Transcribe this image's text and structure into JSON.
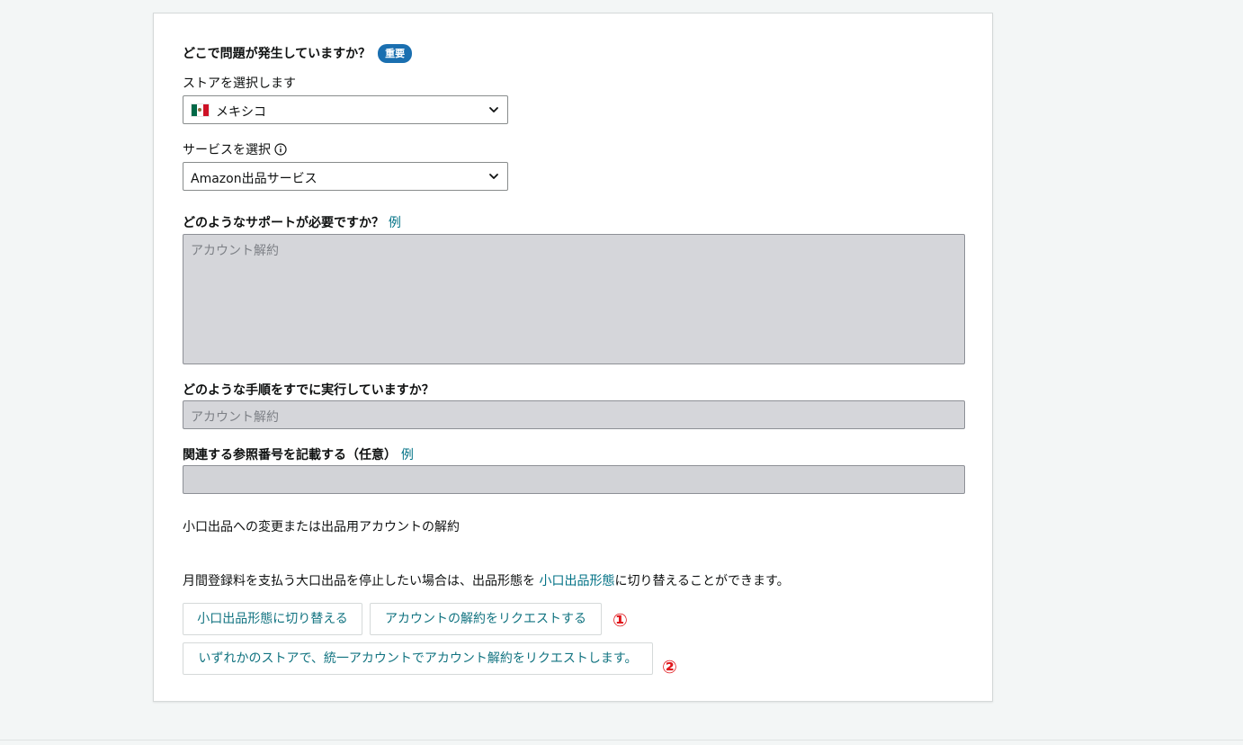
{
  "question1": {
    "title": "どこで問題が発生していますか？",
    "badge": "重要"
  },
  "store": {
    "label": "ストアを選択します",
    "value": "メキシコ",
    "flag_icon": "mexico-flag-icon"
  },
  "service": {
    "label": "サービスを選択",
    "value": "Amazon出品サービス",
    "info_icon": "info-icon"
  },
  "support": {
    "title": "どのようなサポートが必要ですか？",
    "example_link": "例",
    "placeholder": "アカウント解約"
  },
  "steps": {
    "title": "どのような手順をすでに実行していますか？",
    "placeholder": "アカウント解約"
  },
  "reference": {
    "title": "関連する参照番号を記載する（任意）",
    "example_link": "例",
    "value": ""
  },
  "section": {
    "heading": "小口出品への変更または出品用アカウントの解約",
    "description_before": "月間登録料を支払う大口出品を停止したい場合は、出品形態を ",
    "description_link": "小口出品形態",
    "description_after": "に切り替えることができます。"
  },
  "buttons": {
    "switch_plan": "小口出品形態に切り替える",
    "request_close": "アカウントの解約をリクエストする",
    "request_close_unified": "いずれかのストアで、統一アカウントでアカウント解約をリクエストします。"
  },
  "annotations": {
    "marker1": "①",
    "marker2": "②"
  },
  "colors": {
    "link": "#007185",
    "badge": "#1a6fb0",
    "marker": "#e0161b",
    "disabled_field": "#d5d6da"
  }
}
